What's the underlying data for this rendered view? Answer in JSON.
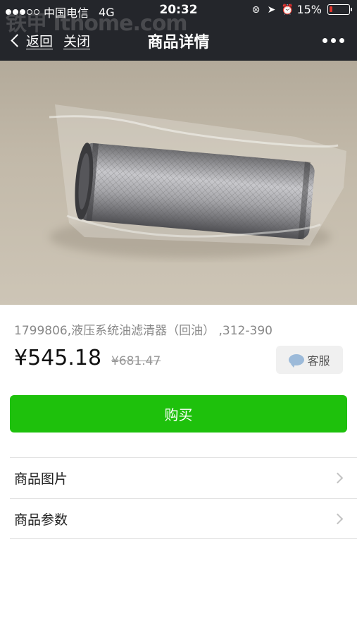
{
  "status_bar": {
    "signal_dots": 5,
    "signal_filled": 3,
    "carrier": "中国电信",
    "network": "4G",
    "time": "20:32",
    "battery": "15%",
    "battery_level": 0.15
  },
  "watermark": "铁甲 Ithome.com",
  "nav": {
    "back_label": "返回",
    "close_label": "关闭",
    "title": "商品详情"
  },
  "product": {
    "name": "1799806,液压系统油滤清器（回油） ,312-390",
    "price": "¥545.18",
    "original_price": "¥681.47"
  },
  "customer_service_label": "客服",
  "buy_label": "购买",
  "list_items": [
    {
      "label": "商品图片"
    },
    {
      "label": "商品参数"
    }
  ],
  "colors": {
    "header_bg": "#24262b",
    "buy_button": "#1ec10c",
    "battery_low": "#e4362b"
  }
}
